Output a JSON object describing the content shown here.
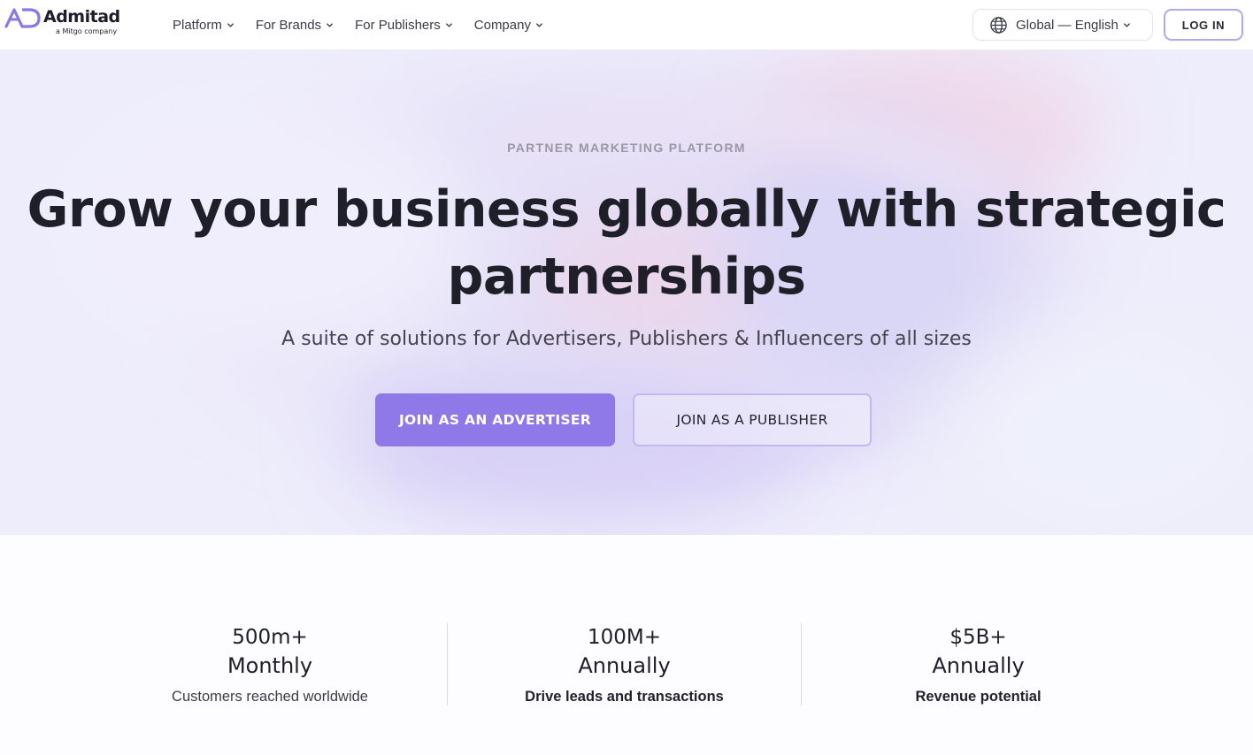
{
  "header": {
    "logo": {
      "name": "Admitad",
      "tagline": "a Mitgo company",
      "brand_color": "#8b78e6"
    },
    "nav": [
      {
        "label": "Platform",
        "icon": "chevron-down-icon"
      },
      {
        "label": "For Brands",
        "icon": "chevron-down-icon"
      },
      {
        "label": "For Publishers",
        "icon": "chevron-down-icon"
      },
      {
        "label": "Company",
        "icon": "chevron-down-icon"
      }
    ],
    "language": {
      "label": "Global — English",
      "icon": "globe-icon"
    },
    "login_label": "LOG IN"
  },
  "hero": {
    "eyebrow": "PARTNER MARKETING PLATFORM",
    "headline_line1": "Grow your business globally with strategic",
    "headline_line2": "partnerships",
    "subtitle": "A suite of solutions for Advertisers, Publishers & Influencers of all sizes",
    "cta_primary": "JOIN AS AN ADVERTISER",
    "cta_secondary": "JOIN AS A PUBLISHER",
    "accent_color": "#8f78e8"
  },
  "stats": [
    {
      "value": "500m+",
      "period": "Monthly",
      "description": "Customers reached worldwide"
    },
    {
      "value": "100M+",
      "period": "Annually",
      "description": "Drive leads and transactions"
    },
    {
      "value": "$5B+",
      "period": "Annually",
      "description": "Revenue potential"
    }
  ]
}
